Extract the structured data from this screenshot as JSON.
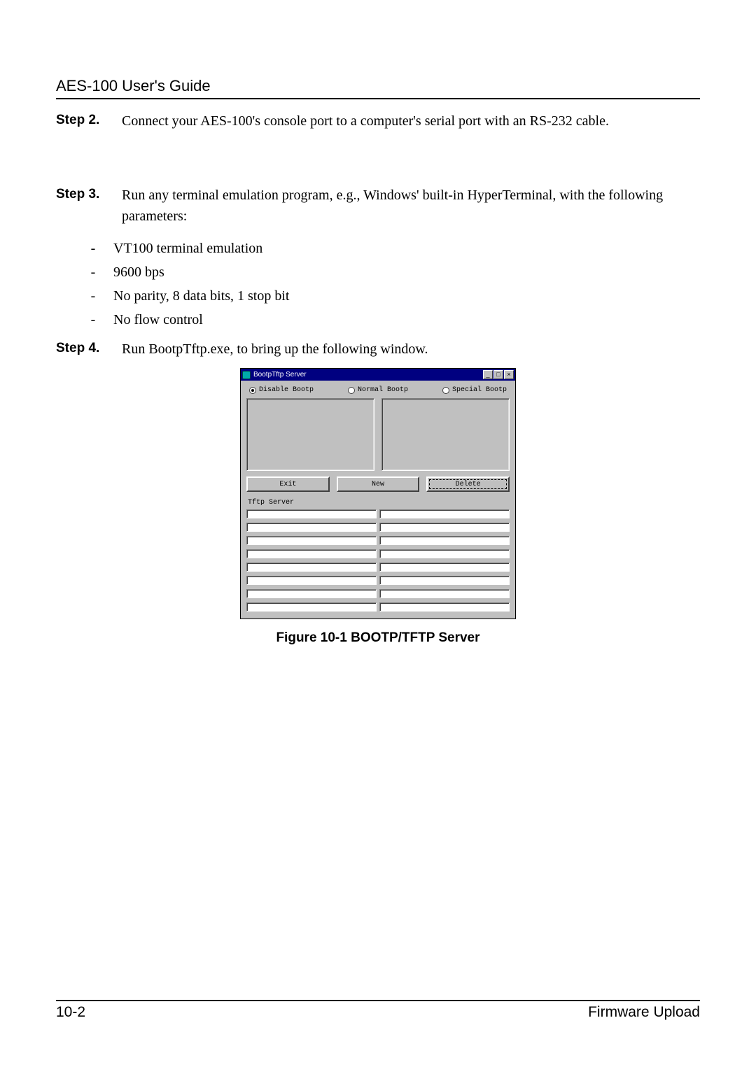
{
  "header": {
    "title": "AES-100 User's Guide"
  },
  "steps": {
    "s2": {
      "label": "Step 2.",
      "text": "Connect your AES-100's console port to a computer's serial port with an RS-232 cable."
    },
    "s3": {
      "label": "Step 3.",
      "text": "Run any terminal emulation program, e.g., Windows' built-in HyperTerminal, with the following parameters:",
      "items": {
        "a": "VT100 terminal emulation",
        "b": "9600 bps",
        "c": "No parity, 8 data bits, 1 stop bit",
        "d": "No flow control"
      }
    },
    "s4": {
      "label": "Step 4.",
      "text": "Run BootpTftp.exe, to bring up the following window."
    }
  },
  "window": {
    "title": "BootpTftp Server",
    "sysbtns": {
      "min": "_",
      "max": "□",
      "close": "×"
    },
    "radios": {
      "disable": "Disable Bootp",
      "normal": "Normal Bootp",
      "special": "Special Bootp",
      "selected": "disable"
    },
    "buttons": {
      "exit": "Exit",
      "new": "New",
      "delete": "Delete"
    },
    "tftp_label": "Tftp Server"
  },
  "caption": "Figure 10-1 BOOTP/TFTP Server",
  "footer": {
    "page": "10-2",
    "section": "Firmware Upload"
  }
}
